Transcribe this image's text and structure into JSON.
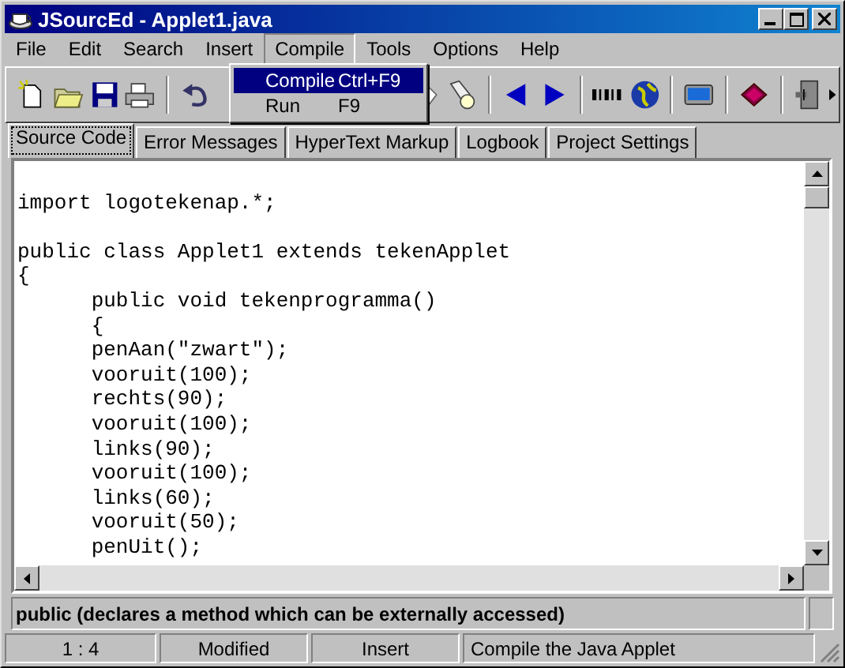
{
  "window": {
    "title": "JSourcEd - Applet1.java"
  },
  "menu": [
    {
      "label": "File",
      "open": false
    },
    {
      "label": "Edit",
      "open": false
    },
    {
      "label": "Search",
      "open": false
    },
    {
      "label": "Insert",
      "open": false
    },
    {
      "label": "Compile",
      "open": true
    },
    {
      "label": "Tools",
      "open": false
    },
    {
      "label": "Options",
      "open": false
    },
    {
      "label": "Help",
      "open": false
    }
  ],
  "dropdown": [
    {
      "label": "Compile",
      "shortcut": "Ctrl+F9",
      "selected": true
    },
    {
      "label": "Run",
      "shortcut": "F9",
      "selected": false
    }
  ],
  "tabs": [
    {
      "label": "Source Code",
      "selected": true
    },
    {
      "label": "Error Messages",
      "selected": false
    },
    {
      "label": "HyperText Markup",
      "selected": false
    },
    {
      "label": "Logbook",
      "selected": false
    },
    {
      "label": "Project Settings",
      "selected": false
    }
  ],
  "editor": {
    "lines": [
      {
        "text": "import logotekenap.*;",
        "blank_before": true
      },
      {
        "text": "public class Applet1 extends tekenApplet",
        "blank_before": true
      },
      "{",
      "\tpublic void tekenprogramma()",
      "\t{",
      "\tpenAan(\"zwart\");",
      "\tvooruit(100);",
      "\trechts(90);",
      "\tvooruit(100);",
      "\tlinks(90);",
      "\tvooruit(100);",
      "\tlinks(60);",
      "\tvooruit(50);",
      "\tpenUit();"
    ]
  },
  "hint": "public (declares a method which can be externally accessed)",
  "status_bar": [
    "1 : 4",
    "Modified",
    "Insert",
    "Compile the Java Applet"
  ]
}
